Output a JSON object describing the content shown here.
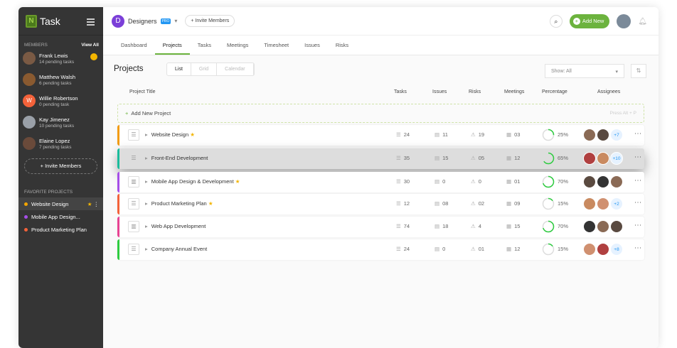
{
  "sidebar": {
    "logo": "Task",
    "members_label": "MEMBERS",
    "view_all": "View All",
    "members": [
      {
        "name": "Frank Lewis",
        "tasks": "14 pending tasks",
        "color": "#7a5a44"
      },
      {
        "name": "Matthew Walsh",
        "tasks": "6 pending tasks",
        "color": "#8a5a30"
      },
      {
        "name": "Willie Robertson",
        "tasks": "0 pending task",
        "initial": "W",
        "color": "#f4623a"
      },
      {
        "name": "Kay Jimenez",
        "tasks": "10 pending tasks",
        "color": "#9aa0a8"
      },
      {
        "name": "Elaine Lopez",
        "tasks": "7 pending tasks",
        "color": "#6a4a3a"
      }
    ],
    "invite": "Invite Members",
    "favorites_label": "FAVORITE PROJECTS",
    "favorites": [
      {
        "label": "Website Design",
        "color": "#f3a500"
      },
      {
        "label": "Mobile App Design...",
        "color": "#a64ee8"
      },
      {
        "label": "Product Marketing Plan",
        "color": "#f4623a"
      }
    ]
  },
  "header": {
    "workspace_initial": "D",
    "workspace": "Designers",
    "badge": "PRO",
    "invite": "+ Invite Members",
    "add_new": "Add New"
  },
  "tabs": [
    "Dashboard",
    "Projects",
    "Tasks",
    "Meetings",
    "Timesheet",
    "Issues",
    "Risks"
  ],
  "page": {
    "title": "Projects",
    "views": [
      "List",
      "Grid",
      "Calendar"
    ],
    "show": "Show: All",
    "add_project": "Add New Project",
    "shortcut": "Press Alt + P"
  },
  "columns": [
    "Project Title",
    "Tasks",
    "Issues",
    "Risks",
    "Meetings",
    "Percentage",
    "Assignees"
  ],
  "projects": [
    {
      "name": "Website Design",
      "star": true,
      "tasks": "24",
      "issues": "11",
      "risks": "19",
      "meetings": "03",
      "percent": 25,
      "pct": "25%",
      "more": "+7",
      "color": "#f39c12",
      "icon": "list"
    },
    {
      "name": "Front-End Development",
      "star": false,
      "tasks": "35",
      "issues": "15",
      "risks": "05",
      "meetings": "12",
      "percent": 65,
      "pct": "65%",
      "more": "+10",
      "color": "#1abc9c",
      "icon": "list"
    },
    {
      "name": "Mobile App Design & Development",
      "star": true,
      "tasks": "30",
      "issues": "0",
      "risks": "0",
      "meetings": "01",
      "percent": 70,
      "pct": "70%",
      "more": "",
      "color": "#a64ee8",
      "icon": "board"
    },
    {
      "name": "Product Marketing Plan",
      "star": true,
      "tasks": "12",
      "issues": "08",
      "risks": "02",
      "meetings": "09",
      "percent": 15,
      "pct": "15%",
      "more": "+2",
      "color": "#f4623a",
      "icon": "list"
    },
    {
      "name": "Web App Development",
      "star": false,
      "tasks": "74",
      "issues": "18",
      "risks": "4",
      "meetings": "15",
      "percent": 70,
      "pct": "70%",
      "more": "",
      "color": "#e84393",
      "icon": "board"
    },
    {
      "name": "Company Annual Event",
      "star": false,
      "tasks": "24",
      "issues": "0",
      "risks": "01",
      "meetings": "12",
      "percent": 15,
      "pct": "15%",
      "more": "+8",
      "color": "#2ecc40",
      "icon": "list"
    }
  ]
}
